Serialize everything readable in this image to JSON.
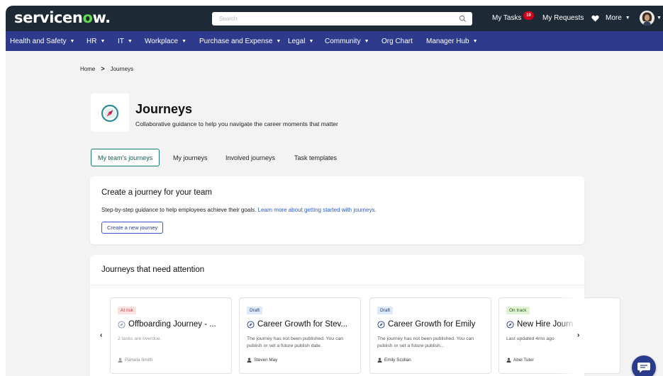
{
  "brand": {
    "logo_text_a": "servicen",
    "logo_o": "o",
    "logo_text_b": "w.",
    "logo_green": "#62d84e"
  },
  "topbar": {
    "search_placeholder": "Search",
    "my_tasks": "My Tasks",
    "my_tasks_count": "10",
    "my_requests": "My Requests",
    "more": "More"
  },
  "nav": {
    "items": [
      {
        "label": "Health and Safety",
        "dropdown": true
      },
      {
        "label": "HR",
        "dropdown": true
      },
      {
        "label": "IT",
        "dropdown": true
      },
      {
        "label": "Workplace",
        "dropdown": true
      },
      {
        "label": "Purchase and Expense",
        "dropdown": true
      },
      {
        "label": "Legal",
        "dropdown": true
      },
      {
        "label": "Community",
        "dropdown": true
      },
      {
        "label": "Org Chart",
        "dropdown": false
      },
      {
        "label": "Manager Hub",
        "dropdown": true
      }
    ]
  },
  "breadcrumb": {
    "home": "Home",
    "separator": ">",
    "current": "Journeys"
  },
  "page": {
    "title": "Journeys",
    "subtitle": "Collaborative guidance to help you navigate the career moments that matter"
  },
  "tabs": [
    {
      "label": "My team's journeys",
      "active": true
    },
    {
      "label": "My journeys",
      "active": false
    },
    {
      "label": "Involved journeys",
      "active": false
    },
    {
      "label": "Task templates",
      "active": false
    }
  ],
  "create_panel": {
    "title": "Create a journey for your team",
    "text": "Step-by-step guidance to help employees achieve their goals.",
    "link": "Learn more about getting started with journeys.",
    "button": "Create a new journey"
  },
  "attention_panel": {
    "title": "Journeys that need attention",
    "prev": "‹",
    "next": "›",
    "cards": [
      {
        "status": "At risk",
        "status_type": "risk",
        "title": "Offboarding Journey - ...",
        "desc": "2 tasks are overdue.",
        "person": "Pamela Smith",
        "faded": true
      },
      {
        "status": "Draft",
        "status_type": "draft",
        "title": "Career Growth for Stev...",
        "desc": "The journey has not been published. You can publish or set a future publish date.",
        "person": "Steven May",
        "faded": false
      },
      {
        "status": "Draft",
        "status_type": "draft",
        "title": "Career Growth for Emily",
        "desc": "The journey has not been published. You can publish or set a future publish...",
        "person": "Emily Scollan",
        "faded": false
      },
      {
        "status": "On track",
        "status_type": "ok",
        "title": "New Hire Journ",
        "desc": "Last updated 4mo ago",
        "person": "Abel Tuter",
        "faded": false
      }
    ]
  },
  "colors": {
    "topbar": "#1d2a36",
    "navbar": "#2e3a8c",
    "accent_teal": "#1c7a74",
    "link_blue": "#2b58d6",
    "badge_red": "#d0021b"
  },
  "icons": [
    "magnifier-icon",
    "heart-icon",
    "avatar",
    "compass-icon",
    "person-icon",
    "chat-icon"
  ]
}
